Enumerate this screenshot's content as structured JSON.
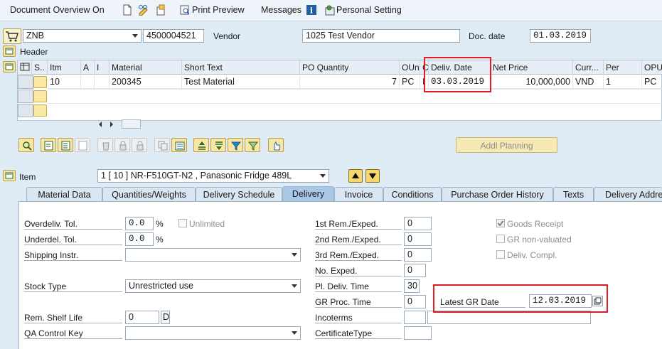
{
  "menubar": {
    "doc_overview": "Document Overview On",
    "print_preview": "Print Preview",
    "messages": "Messages",
    "personal_setting": "Personal Setting"
  },
  "header": {
    "doc_type": "ZNB",
    "po_number": "4500004521",
    "vendor_label": "Vendor",
    "vendor_value": "1025 Test Vendor",
    "doc_date_label": "Doc. date",
    "doc_date_value": "01.03.2019",
    "header_label": "Header"
  },
  "grid": {
    "columns": [
      "S..",
      "Itm",
      "A",
      "I",
      "Material",
      "Short Text",
      "PO Quantity",
      "OUn",
      "C",
      "Deliv. Date",
      "Net Price",
      "Curr...",
      "Per",
      "OPU"
    ],
    "rows": [
      {
        "itm": "10",
        "material": "200345",
        "short_text": "Test Material",
        "qty": "7",
        "oun": "PC",
        "c": "I",
        "deliv_date": "03.03.2019",
        "net_price": "10,000,000",
        "curr": "VND",
        "per": "1",
        "opu": "PC"
      }
    ]
  },
  "toolbar": {
    "addl_planning": "Addl Planning"
  },
  "item": {
    "label": "Item",
    "selected": "1 [ 10 ] NR-F510GT-N2 , Panasonic Fridge 489L"
  },
  "tabs": [
    "Material Data",
    "Quantities/Weights",
    "Delivery Schedule",
    "Delivery",
    "Invoice",
    "Conditions",
    "Purchase Order History",
    "Texts",
    "Delivery Address"
  ],
  "delivery": {
    "overdeliv_label": "Overdeliv. Tol.",
    "overdeliv_value": "0.0",
    "pct": "%",
    "unlimited_label": "Unlimited",
    "underdel_label": "Underdel. Tol.",
    "underdel_value": "0.0",
    "shipping_label": "Shipping Instr.",
    "stock_type_label": "Stock Type",
    "stock_type_value": "Unrestricted use",
    "rem_shelf_label": "Rem. Shelf Life",
    "rem_shelf_value": "0",
    "rem_shelf_unit": "D",
    "qa_label": "QA Control Key",
    "rem1_label": "1st Rem./Exped.",
    "rem1_value": "0",
    "rem2_label": "2nd Rem./Exped.",
    "rem2_value": "0",
    "rem3_label": "3rd Rem./Exped.",
    "rem3_value": "0",
    "no_exped_label": "No. Exped.",
    "no_exped_value": "0",
    "pl_deliv_label": "Pl. Deliv. Time",
    "pl_deliv_value": "30",
    "gr_proc_label": "GR Proc. Time",
    "gr_proc_value": "0",
    "incoterms_label": "Incoterms",
    "cert_label": "CertificateType",
    "goods_receipt_label": "Goods Receipt",
    "gr_nonval_label": "GR non-valuated",
    "deliv_compl_label": "Deliv. Compl.",
    "latest_gr_label": "Latest GR Date",
    "latest_gr_value": "12.03.2019"
  },
  "colors": {
    "highlight": "#e01c24",
    "background": "#dfebf5",
    "active_tab": "#a9c7e6"
  }
}
